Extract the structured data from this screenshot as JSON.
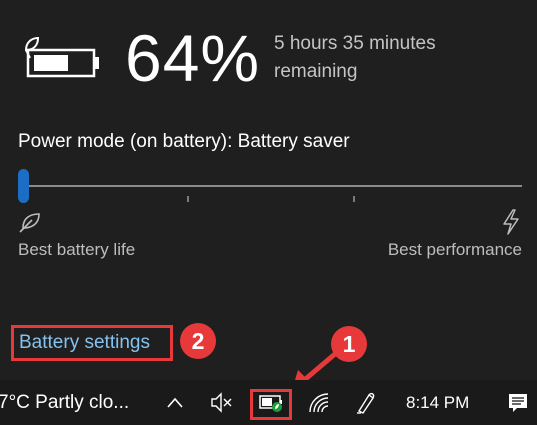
{
  "flyout": {
    "percent": "64%",
    "time_remaining": "5 hours 35 minutes remaining",
    "power_mode_label": "Power mode (on battery): Battery saver",
    "slider": {
      "level_fraction": 0.0,
      "left_label": "Best battery life",
      "right_label": "Best performance",
      "left_icon": "leaf-icon",
      "right_icon": "lightning-bolt-icon"
    },
    "battery_settings_link": "Battery settings",
    "battery_level_fraction": 0.64
  },
  "annotations": {
    "step1": "1",
    "step2": "2",
    "highlight_color": "#e8393a"
  },
  "taskbar": {
    "weather": "7°C  Partly clo...",
    "time": "8:14 PM",
    "icons": [
      "chevron-up-icon",
      "mute-speaker-icon",
      "battery-saver-icon",
      "wifi-icon",
      "pen-icon",
      "notification-icon"
    ]
  },
  "colors": {
    "accent": "#1c6ec4",
    "link": "#84c2ef",
    "background": "#1f1f1f"
  }
}
